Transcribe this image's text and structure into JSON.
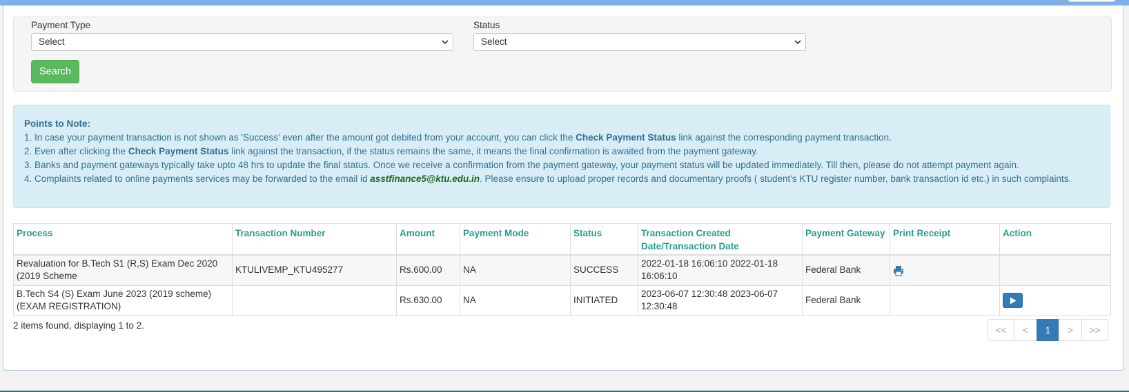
{
  "filters": {
    "payment_type": {
      "label": "Payment Type",
      "selected": "Select"
    },
    "status": {
      "label": "Status",
      "selected": "Select"
    },
    "search_label": "Search"
  },
  "notes": {
    "heading": "Points to Note:",
    "n1_a": "1. In case your payment transaction is not shown as 'Success' even after the amount got debited from your account, you can click the ",
    "n1_b": "Check Payment Status",
    "n1_c": " link against the corresponding payment transaction.",
    "n2_a": "2. Even after clicking the ",
    "n2_b": "Check Payment Status",
    "n2_c": " link against the transaction, if the status remains the same, it means the final confirmation is awaited from the payment gateway.",
    "n3": "3. Banks and payment gateways typically take upto 48 hrs to update the final status. Once we receive a confirmation from the payment gateway, your payment status will be updated immediately. Till then, please do not attempt payment again.",
    "n4_a": "4. Complaints related to online payments services may be forwarded to the email id ",
    "n4_email": "asstfinance5@ktu.edu.in",
    "n4_b": ". Please ensure to upload proper records and documentary proofs ( student's KTU register number, bank transaction id etc.) in such complaints."
  },
  "table": {
    "columns": [
      "Process",
      "Transaction Number",
      "Amount",
      "Payment Mode",
      "Status",
      "Transaction Created Date/Transaction Date",
      "Payment Gateway",
      "Print Receipt",
      "Action"
    ],
    "rows": [
      {
        "process": "Revaluation for B.Tech S1 (R,S) Exam Dec 2020 (2019 Scheme",
        "txn": "KTULIVEMP_KTU495277",
        "amount": "Rs.600.00",
        "mode": "NA",
        "status": "SUCCESS",
        "dates": "2022-01-18 16:06:10 2022-01-18 16:06:10",
        "gateway": "Federal Bank",
        "receipt_icon": "print-icon",
        "action_icon": ""
      },
      {
        "process": "B.Tech S4 (S) Exam June 2023 (2019 scheme) (EXAM REGISTRATION)",
        "txn": "",
        "amount": "Rs.630.00",
        "mode": "NA",
        "status": "INITIATED",
        "dates": "2023-06-07 12:30:48 2023-06-07 12:30:48",
        "gateway": "Federal Bank",
        "receipt_icon": "",
        "action_icon": "play-icon"
      }
    ]
  },
  "summary": "2 items found, displaying 1 to 2.",
  "pagination": {
    "first": "<<",
    "prev": "<",
    "current": "1",
    "next": ">",
    "last": ">>"
  },
  "colors": {
    "header_text": "#2a9d8f",
    "search_button": "#5cb85c",
    "alert_bg": "#d9edf7",
    "primary": "#337ab7"
  }
}
